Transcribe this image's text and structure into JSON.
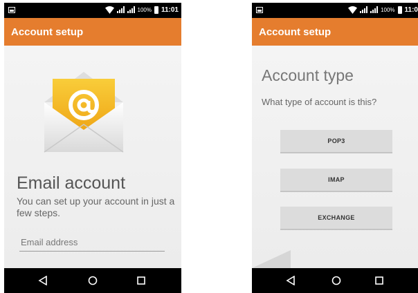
{
  "status_bar": {
    "battery_percent": "100%",
    "time_left": "11:01",
    "time_right": "11:0"
  },
  "left_screen": {
    "app_bar_title": "Account setup",
    "heading": "Email account",
    "description": "You can set up your account in just a few steps.",
    "email_field": {
      "value": "",
      "placeholder": "Email address"
    }
  },
  "right_screen": {
    "app_bar_title": "Account setup",
    "heading": "Account type",
    "question": "What type of account is this?",
    "options": [
      "POP3",
      "IMAP",
      "EXCHANGE"
    ]
  },
  "icons": {
    "notification": "notification-icon",
    "wifi": "wifi-icon",
    "signal": "signal-icon",
    "battery": "battery-icon",
    "envelope": "email-envelope-icon",
    "back": "back-icon",
    "home": "home-icon",
    "recents": "recents-icon"
  },
  "colors": {
    "app_bar": "#e57d2e",
    "envelope_card": "#f2b51c",
    "button_bg": "#dcdcdc",
    "background": "#f0f0f0"
  }
}
